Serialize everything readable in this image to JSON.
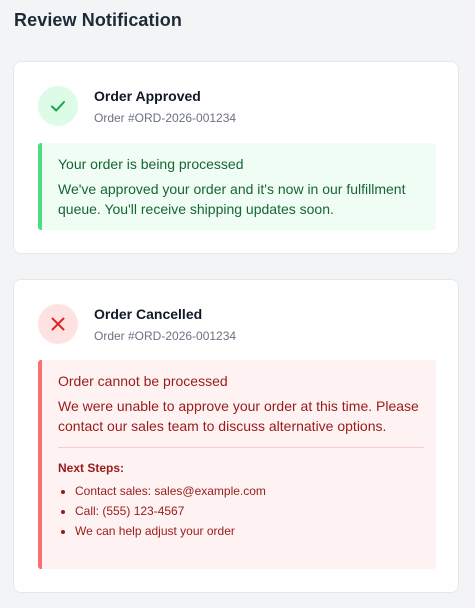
{
  "page": {
    "title": "Review Notification"
  },
  "approved": {
    "title": "Order Approved",
    "order_number": "Order #ORD-2026-001234",
    "icon": "check-icon",
    "alert_heading": "Your order is being processed",
    "alert_body": "We've approved your order and it's now in our fulfillment queue. You'll receive shipping updates soon.",
    "colors": {
      "accent": "#16a34a",
      "background": "#f0fdf4",
      "border": "#4ade80"
    }
  },
  "cancelled": {
    "title": "Order Cancelled",
    "order_number": "Order #ORD-2026-001234",
    "icon": "x-icon",
    "alert_heading": "Order cannot be processed",
    "alert_body": "We were unable to approve your order at this time. Please contact our sales team to discuss alternative options.",
    "next_steps_label": "Next Steps:",
    "next_steps": [
      "Contact sales: sales@example.com",
      "Call: (555) 123-4567",
      "We can help adjust your order"
    ],
    "colors": {
      "accent": "#dc2626",
      "background": "#fef2f2",
      "border": "#f87171"
    }
  }
}
